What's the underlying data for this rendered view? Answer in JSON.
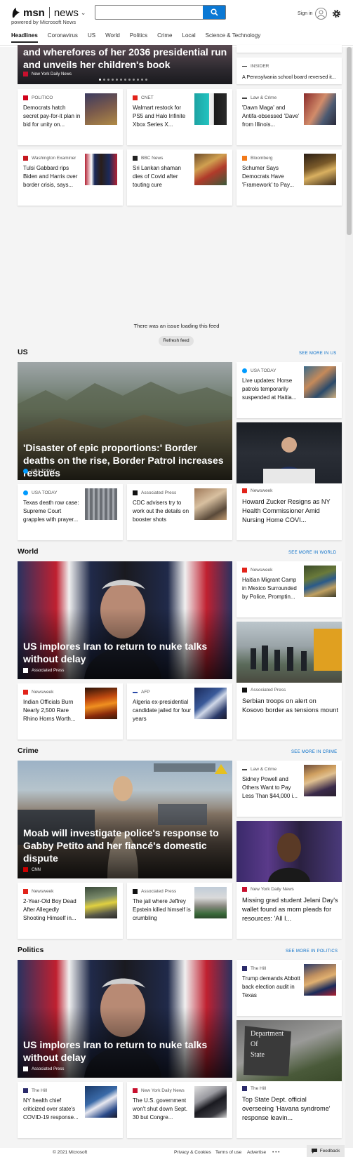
{
  "header": {
    "logo_text": "msn",
    "section_name": "news",
    "powered_by": "powered by Microsoft News",
    "search_placeholder": "",
    "signin_label": "Sign in"
  },
  "nav": {
    "tabs": [
      {
        "label": "Headlines"
      },
      {
        "label": "Coronavirus"
      },
      {
        "label": "US"
      },
      {
        "label": "World"
      },
      {
        "label": "Politics"
      },
      {
        "label": "Crime"
      },
      {
        "label": "Local"
      },
      {
        "label": "Science & Technology"
      }
    ]
  },
  "top": {
    "hero": {
      "title": "and wherefores of her 2036 presidential run and unveils her children's book",
      "source": "New York Daily News"
    },
    "side_source": "INSIDER",
    "side_title": "A Pennsylvania school board reversed it...",
    "row1": [
      {
        "source": "POLITICO",
        "title": "Democrats hatch secret pay-for-it plan in bid for unity on..."
      },
      {
        "source": "CNET",
        "title": "Walmart restock for PS5 and Halo Infinite Xbox Series X..."
      },
      {
        "source": "Law & Crime",
        "title": "'Dawn Maga' and Antifa-obsessed 'Dave' from Illinois..."
      }
    ],
    "row2": [
      {
        "source": "Washington Examiner",
        "title": "Tulsi Gabbard rips Biden and Harris over border crisis, says..."
      },
      {
        "source": "BBC News",
        "title": "Sri Lankan shaman dies of Covid after touting cure"
      },
      {
        "source": "Bloomberg",
        "title": "Schumer Says Democrats Have 'Framework' to Pay..."
      }
    ]
  },
  "feed_error": {
    "message": "There was an issue loading this feed",
    "button": "Refresh feed"
  },
  "sections": {
    "us": {
      "title": "US",
      "see_more": "SEE MORE IN US",
      "hero": {
        "title": "'Disaster of epic proportions:' Border deaths on the rise, Border Patrol increases rescues",
        "source": "USA TODAY"
      },
      "side1": {
        "source": "USA TODAY",
        "title": "Live updates: Horse patrols temporarily suspended at Haitia..."
      },
      "side2": {
        "source": "Newsweek",
        "title": "Howard Zucker Resigns as NY Health Commissioner Amid Nursing Home COVI..."
      },
      "b1": {
        "source": "USA TODAY",
        "title": "Texas death row case: Supreme Court grapples with prayer..."
      },
      "b2": {
        "source": "Associated Press",
        "title": "CDC advisers try to work out the details on booster shots"
      }
    },
    "world": {
      "title": "World",
      "see_more": "SEE MORE IN WORLD",
      "hero": {
        "title": "US implores Iran to return to nuke talks without delay",
        "source": "Associated Press"
      },
      "side1": {
        "source": "Newsweek",
        "title": "Haitian Migrant Camp in Mexico Surrounded by Police, Promptin..."
      },
      "side2": {
        "source": "Associated Press",
        "title": "Serbian troops on alert on Kosovo border as tensions mount"
      },
      "b1": {
        "source": "Newsweek",
        "title": "Indian Officials Burn Nearly 2,500 Rare Rhino Horns Worth..."
      },
      "b2": {
        "source": "AFP",
        "title": "Algeria ex-presidential candidate jailed for four years"
      }
    },
    "crime": {
      "title": "Crime",
      "see_more": "SEE MORE IN CRIME",
      "hero": {
        "title": "Moab will investigate police's response to Gabby Petito and her fiancé's domestic dispute",
        "source": "CNN"
      },
      "side1": {
        "source": "Law & Crime",
        "title": "Sidney Powell and Others Want to Pay Less Than $44,000 i..."
      },
      "side2": {
        "source": "New York Daily News",
        "title": "Missing grad student Jelani Day's wallet found as mom pleads for resources: 'All I..."
      },
      "b1": {
        "source": "Newsweek",
        "title": "2-Year-Old Boy Dead After Allegedly Shooting Himself in..."
      },
      "b2": {
        "source": "Associated Press",
        "title": "The jail where Jeffrey Epstein killed himself is crumbling"
      }
    },
    "politics": {
      "title": "Politics",
      "see_more": "SEE MORE IN POLITICS",
      "hero": {
        "title": "US implores Iran to return to nuke talks without delay",
        "source": "Associated Press"
      },
      "side1": {
        "source": "The Hill",
        "title": "Trump demands Abbott back election audit in Texas"
      },
      "side2": {
        "source": "The Hill",
        "title": "Top State Dept. official overseeing 'Havana syndrome' response leavin..."
      },
      "b1": {
        "source": "The Hill",
        "title": "NY health chief criticized over state's COVID-19 response..."
      },
      "b2": {
        "source": "New York Daily News",
        "title": "The U.S. government won't shut down Sept. 30 but Congre..."
      }
    }
  },
  "footer": {
    "copyright": "© 2021 Microsoft",
    "privacy": "Privacy & Cookies",
    "terms": "Terms of use",
    "advertise": "Advertise",
    "more": "• • •",
    "feedback": "Feedback"
  }
}
